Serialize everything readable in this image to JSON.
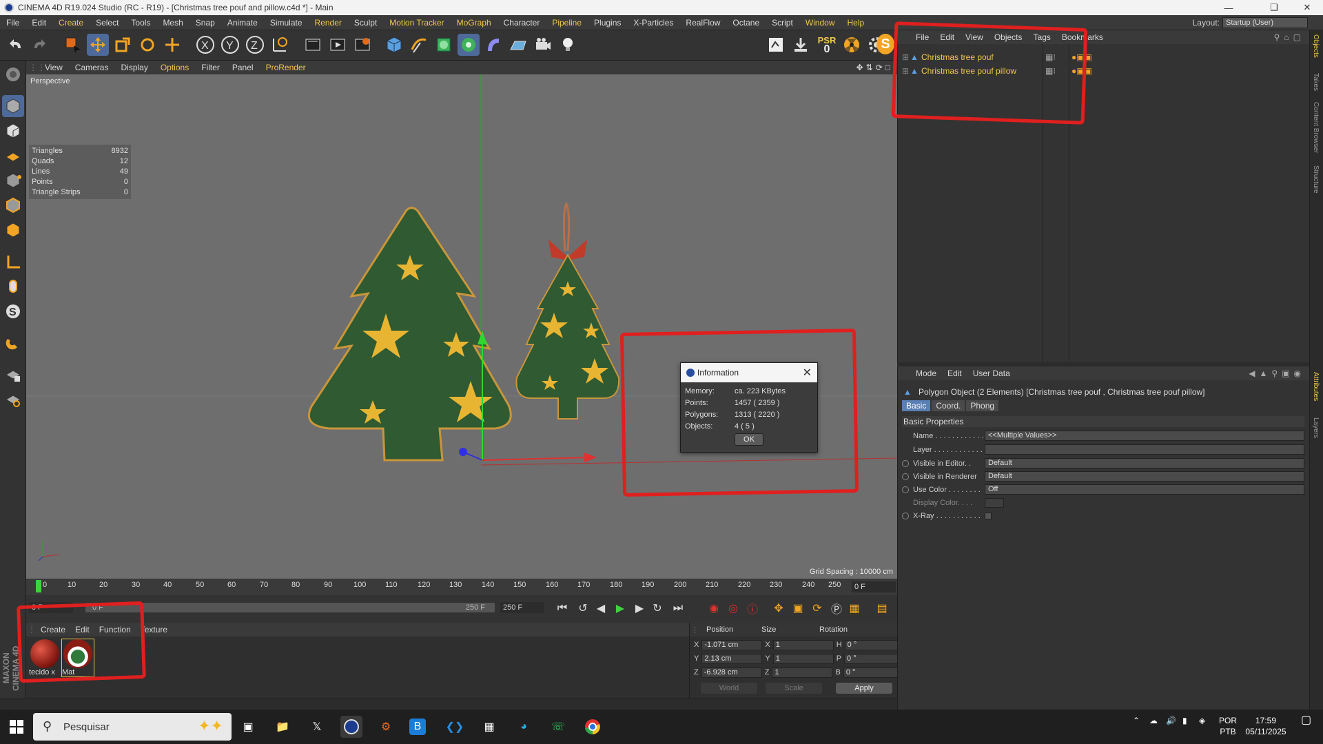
{
  "window": {
    "title": "CINEMA 4D R19.024 Studio (RC - R19) - [Christmas tree pouf and pillow.c4d *] - Main"
  },
  "menu": [
    "File",
    "Edit",
    "Create",
    "Select",
    "Tools",
    "Mesh",
    "Snap",
    "Animate",
    "Simulate",
    "Render",
    "Sculpt",
    "Motion Tracker",
    "MoGraph",
    "Character",
    "Pipeline",
    "Plugins",
    "X-Particles",
    "RealFlow",
    "Octane",
    "Script",
    "Window",
    "Help"
  ],
  "layout": {
    "label": "Layout:",
    "value": "Startup (User)"
  },
  "toolbar": {
    "psr_label": "PSR",
    "psr_value": "0"
  },
  "viewport": {
    "menu": [
      "View",
      "Cameras",
      "Display",
      "Options",
      "Filter",
      "Panel",
      "ProRender"
    ],
    "label": "Perspective",
    "stats": [
      {
        "k": "Triangles",
        "v": "8932"
      },
      {
        "k": "Quads",
        "v": "12"
      },
      {
        "k": "Lines",
        "v": "49"
      },
      {
        "k": "Points",
        "v": "0"
      },
      {
        "k": "Triangle Strips",
        "v": "0"
      }
    ],
    "grid_spacing": "Grid Spacing : 10000 cm"
  },
  "dialog": {
    "title": "Information",
    "rows": [
      {
        "k": "Memory:",
        "v": "ca. 223 KBytes"
      },
      {
        "k": "Points:",
        "v": "1457 ( 2359 )"
      },
      {
        "k": "Polygons:",
        "v": "1313 ( 2220 )"
      },
      {
        "k": "Objects:",
        "v": "4 ( 5 )"
      }
    ],
    "ok": "OK"
  },
  "timeline": {
    "ticks": [
      "0",
      "10",
      "20",
      "30",
      "40",
      "50",
      "60",
      "70",
      "80",
      "90",
      "100",
      "110",
      "120",
      "130",
      "140",
      "150",
      "160",
      "170",
      "180",
      "190",
      "200",
      "210",
      "220",
      "230",
      "240",
      "250"
    ],
    "current_frame": "0 F",
    "range_start": "0 F",
    "range_end_a": "0 F",
    "range_end_b": "250 F",
    "range_end_c": "250 F"
  },
  "materials": {
    "menu": [
      "Create",
      "Edit",
      "Function",
      "Texture"
    ],
    "items": [
      {
        "name": "tecido x"
      },
      {
        "name": "Mat"
      }
    ]
  },
  "coords": {
    "headers": [
      "Position",
      "Size",
      "Rotation"
    ],
    "rows": [
      {
        "axis": "X",
        "pos": "-1.071 cm",
        "saxis": "X",
        "size": "1",
        "raxis": "H",
        "rot": "0 °"
      },
      {
        "axis": "Y",
        "pos": "2.13 cm",
        "saxis": "Y",
        "size": "1",
        "raxis": "P",
        "rot": "0 °"
      },
      {
        "axis": "Z",
        "pos": "-6.928 cm",
        "saxis": "Z",
        "size": "1",
        "raxis": "B",
        "rot": "0 °"
      }
    ],
    "mode": "World",
    "scale": "Scale",
    "apply": "Apply"
  },
  "objects": {
    "menu": [
      "File",
      "Edit",
      "View",
      "Objects",
      "Tags",
      "Bookmarks"
    ],
    "items": [
      {
        "name": "Christmas tree pouf"
      },
      {
        "name": "Christmas tree pouf pillow"
      }
    ]
  },
  "attributes": {
    "menu": [
      "Mode",
      "Edit",
      "User Data"
    ],
    "title": "Polygon Object (2 Elements) [Christmas tree pouf , Christmas tree pouf pillow]",
    "tabs": [
      "Basic",
      "Coord.",
      "Phong"
    ],
    "section": "Basic Properties",
    "rows": [
      {
        "k": "Name . . . . . . . . . . . .",
        "v": "<<Multiple Values>>"
      },
      {
        "k": "Layer . . . . . . . . . . . .",
        "v": ""
      },
      {
        "k": "Visible in Editor. .",
        "v": "Default"
      },
      {
        "k": "Visible in Renderer",
        "v": "Default"
      },
      {
        "k": "Use Color . . . . . . . .",
        "v": "Off"
      },
      {
        "k": "Display Color. . . .",
        "v": ""
      },
      {
        "k": "X-Ray . . . . . . . . . . .",
        "v": ""
      }
    ]
  },
  "right_tabs": [
    "Objects",
    "Takes",
    "Content Browser",
    "Structure",
    "Attributes",
    "Layers"
  ],
  "maxon_label": "MAXON CINEMA 4D",
  "taskbar": {
    "search_placeholder": "Pesquisar",
    "lang1": "POR",
    "lang2": "PTB",
    "time": "17:59",
    "date": "05/11/2025"
  },
  "colors": {
    "accent": "#f2c84b",
    "annotation": "#e01f1f",
    "tree": "#2f5a32",
    "star": "#e8b532"
  }
}
